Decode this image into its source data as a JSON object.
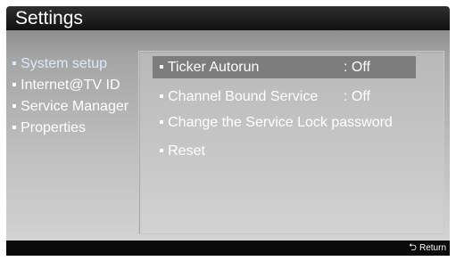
{
  "header": {
    "title": "Settings"
  },
  "left_menu": {
    "items": [
      {
        "label": "▪ System setup",
        "active": true
      },
      {
        "label": "▪ Internet@TV ID"
      },
      {
        "label": "▪ Service Manager"
      },
      {
        "label": "▪ Properties"
      }
    ]
  },
  "options": {
    "ticker_autorun": {
      "label": "▪ Ticker Autorun",
      "value": ": Off",
      "selected": true
    },
    "channel_bound_service": {
      "label": "▪ Channel Bound Service",
      "value": ": Off"
    },
    "change_lock_password": {
      "label": "▪ Change the Service Lock password"
    },
    "reset": {
      "label": "▪ Reset"
    }
  },
  "footer": {
    "return_label": "Return",
    "return_icon": "return-arrow-icon"
  },
  "colors": {
    "title_bar": "#1f1f1f",
    "panel": "#b0b0b0",
    "highlight": "#7d7d7d",
    "active_item": "#dce9f7"
  }
}
